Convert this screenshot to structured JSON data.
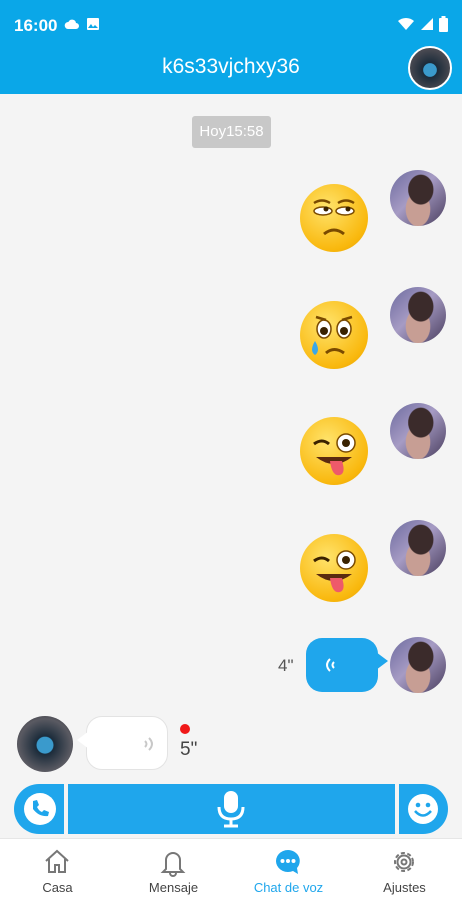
{
  "status_bar": {
    "time": "16:00",
    "icons": [
      "cloud-icon",
      "image-icon",
      "wifi-icon",
      "signal-icon",
      "battery-icon"
    ]
  },
  "header": {
    "title": "k6s33vjchxy36"
  },
  "chat": {
    "timestamp": "Hoy15:58",
    "messages": [
      {
        "side": "self",
        "kind": "emoji",
        "icon": "unamused-face-emoji"
      },
      {
        "side": "self",
        "kind": "emoji",
        "icon": "crying-face-emoji"
      },
      {
        "side": "self",
        "kind": "emoji",
        "icon": "winking-tongue-face-emoji"
      },
      {
        "side": "self",
        "kind": "emoji",
        "icon": "winking-tongue-face-emoji"
      },
      {
        "side": "self",
        "kind": "voice",
        "duration": "4\""
      },
      {
        "side": "other",
        "kind": "voice",
        "duration": "5\"",
        "unread": true
      }
    ]
  },
  "input_bar": {
    "icons": [
      "phone-icon",
      "microphone-icon",
      "smiley-icon"
    ]
  },
  "tabbar": {
    "tabs": [
      {
        "label": "Casa",
        "icon": "home-icon"
      },
      {
        "label": "Mensaje",
        "icon": "bell-icon"
      },
      {
        "label": "Chat de voz",
        "icon": "chat-bubble-icon",
        "active": true
      },
      {
        "label": "Ajustes",
        "icon": "gear-icon"
      }
    ]
  },
  "colors": {
    "accent": "#1fa6ec",
    "header": "#0aa7e8",
    "unread": "#f01818"
  }
}
